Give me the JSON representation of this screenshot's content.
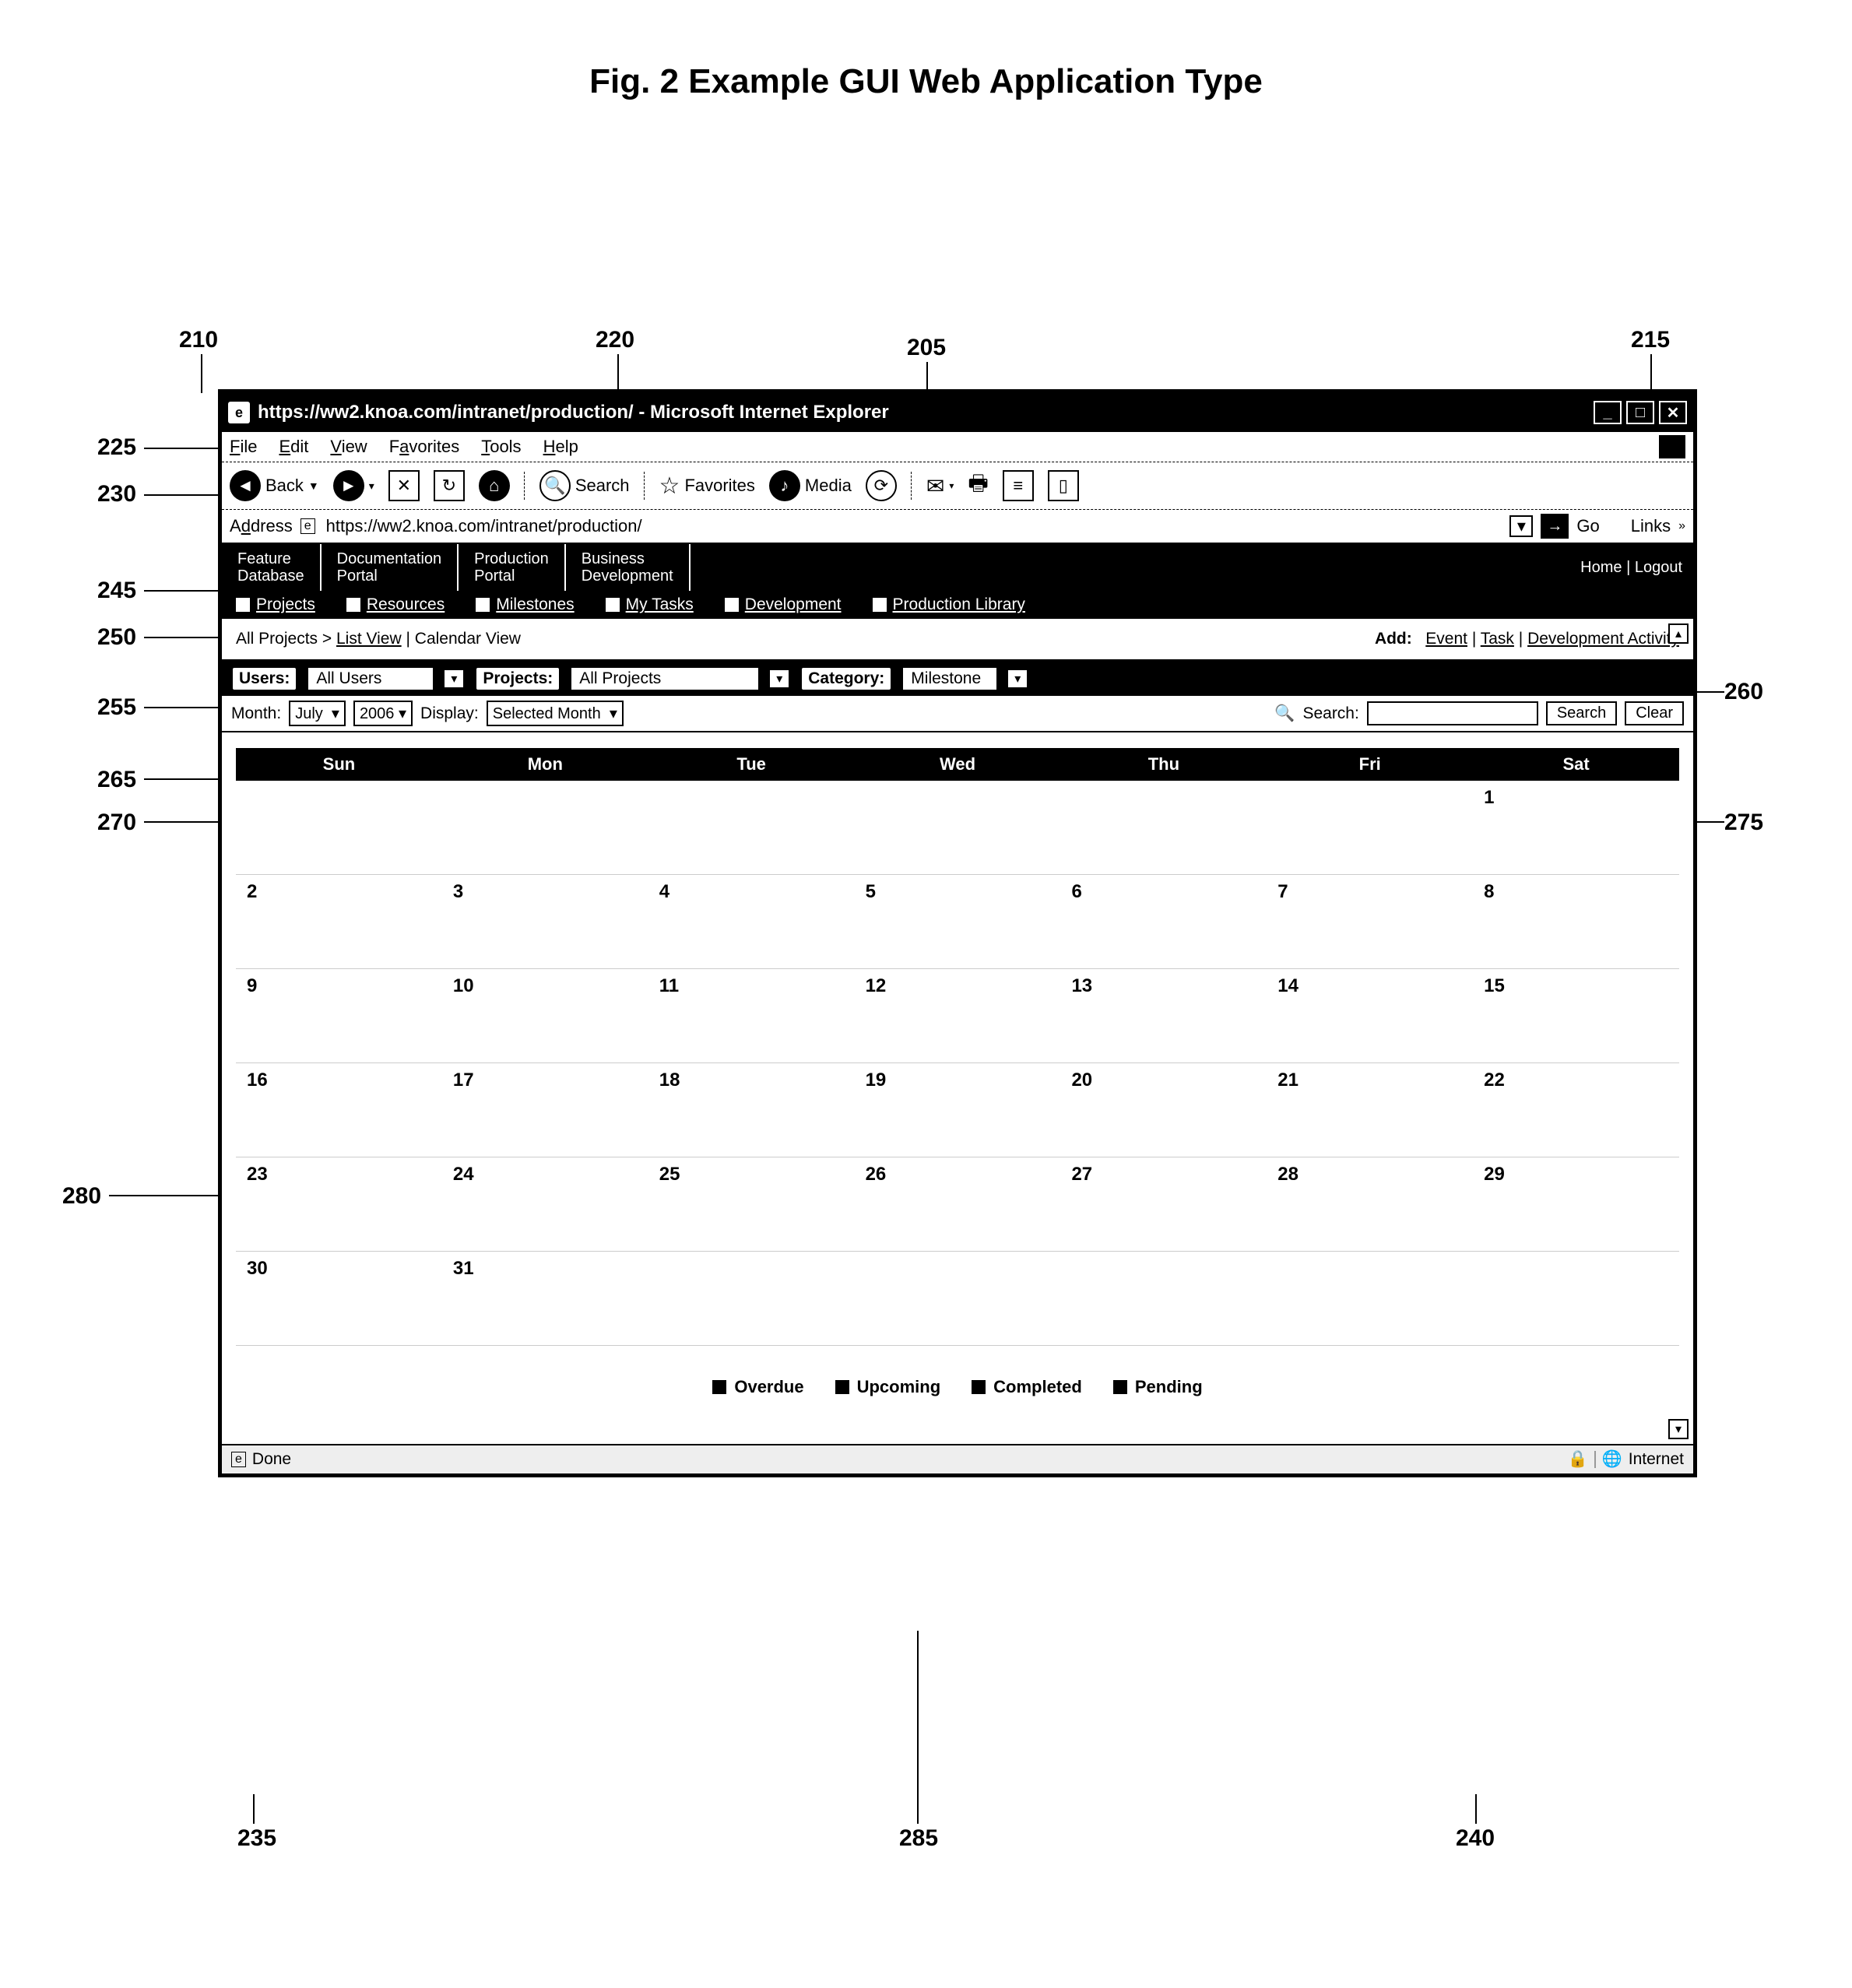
{
  "figure_title": "Fig. 2 Example GUI Web Application Type",
  "callouts": {
    "c210": "210",
    "c220": "220",
    "c205": "205",
    "c215": "215",
    "c225": "225",
    "c230": "230",
    "c245": "245",
    "c250": "250",
    "c255": "255",
    "c260": "260",
    "c265": "265",
    "c270": "270",
    "c275": "275",
    "c280": "280",
    "c235": "235",
    "c285": "285",
    "c240": "240"
  },
  "titlebar": {
    "title": "https://ww2.knoa.com/intranet/production/ - Microsoft Internet Explorer",
    "min": "_",
    "max": "□",
    "close": "✕"
  },
  "menubar": {
    "file": "File",
    "edit": "Edit",
    "view": "View",
    "favorites": "Favorites",
    "tools": "Tools",
    "help": "Help"
  },
  "toolbar": {
    "back": "Back",
    "search": "Search",
    "favorites": "Favorites",
    "media": "Media"
  },
  "address": {
    "label": "Address",
    "url": "https://ww2.knoa.com/intranet/production/",
    "go": "Go",
    "links": "Links"
  },
  "topnav": {
    "tabs": [
      "Feature\nDatabase",
      "Documentation\nPortal",
      "Production\nPortal",
      "Business\nDevelopment"
    ],
    "home": "Home",
    "logout": "Logout"
  },
  "subnav": {
    "items": [
      "Projects",
      "Resources",
      "Milestones",
      "My Tasks",
      "Development",
      "Production Library"
    ]
  },
  "crumbs": {
    "prefix": "All Projects >",
    "list_view": "List View",
    "calendar_view": "Calendar View",
    "add_label": "Add:",
    "add_event": "Event",
    "add_task": "Task",
    "add_dev": "Development Activity"
  },
  "filters": {
    "users_label": "Users:",
    "users_value": "All Users",
    "projects_label": "Projects:",
    "projects_value": "All Projects",
    "category_label": "Category:",
    "category_value": "Milestone"
  },
  "display": {
    "month_label": "Month:",
    "month_value": "July",
    "year_value": "2006",
    "display_label": "Display:",
    "display_value": "Selected Month",
    "search_label": "Search:",
    "search_btn": "Search",
    "clear_btn": "Clear"
  },
  "calendar": {
    "days": [
      "Sun",
      "Mon",
      "Tue",
      "Wed",
      "Thu",
      "Fri",
      "Sat"
    ],
    "weeks": [
      [
        "",
        "",
        "",
        "",
        "",
        "",
        "1"
      ],
      [
        "2",
        "3",
        "4",
        "5",
        "6",
        "7",
        "8"
      ],
      [
        "9",
        "10",
        "11",
        "12",
        "13",
        "14",
        "15"
      ],
      [
        "16",
        "17",
        "18",
        "19",
        "20",
        "21",
        "22"
      ],
      [
        "23",
        "24",
        "25",
        "26",
        "27",
        "28",
        "29"
      ],
      [
        "30",
        "31",
        "",
        "",
        "",
        "",
        ""
      ]
    ]
  },
  "legend": {
    "items": [
      "Overdue",
      "Upcoming",
      "Completed",
      "Pending"
    ]
  },
  "status": {
    "done": "Done",
    "zone": "Internet"
  }
}
